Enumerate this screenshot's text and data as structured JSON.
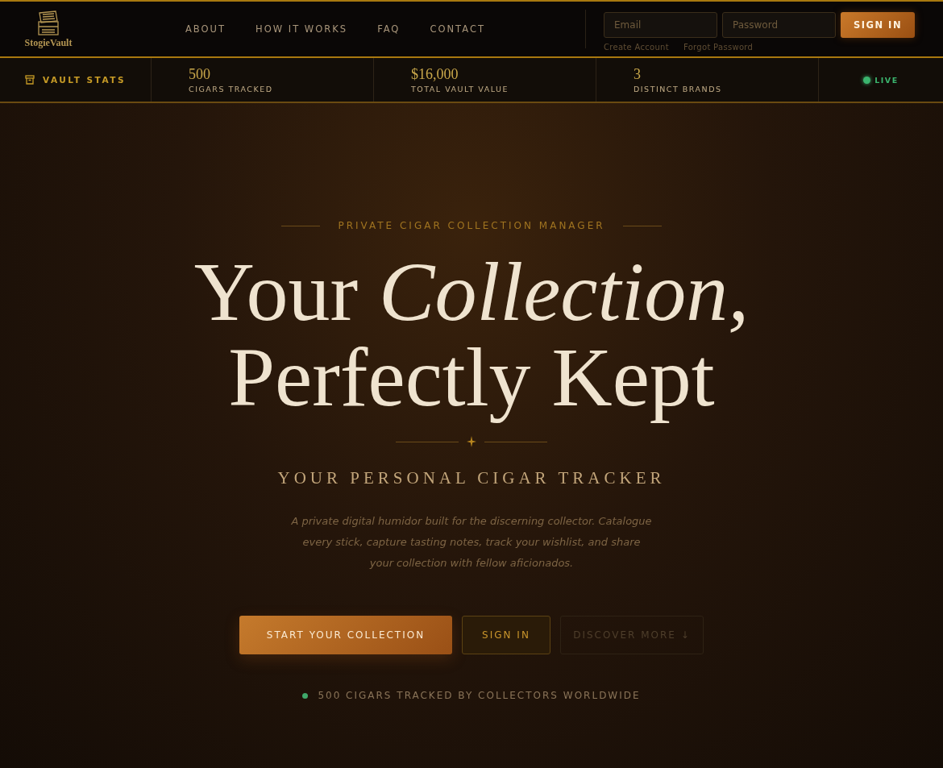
{
  "brand": {
    "name": "StogieVault"
  },
  "nav": [
    "ABOUT",
    "HOW IT WORKS",
    "FAQ",
    "CONTACT"
  ],
  "login": {
    "email_placeholder": "Email",
    "password_placeholder": "Password",
    "button": "SIGN IN",
    "links": [
      "Create Account",
      "Forgot Password"
    ]
  },
  "stats_bar": {
    "title": "VAULT STATS",
    "stats": [
      {
        "value": "500",
        "label": "CIGARS TRACKED"
      },
      {
        "value": "$16,000",
        "label": "TOTAL VAULT VALUE"
      },
      {
        "value": "3",
        "label": "DISTINCT BRANDS"
      }
    ],
    "live": "LIVE"
  },
  "hero": {
    "eyebrow": "PRIVATE CIGAR COLLECTION MANAGER",
    "headline_lines": [
      "Your *Collection,*",
      "Perfectly Kept"
    ],
    "subtitle": "YOUR PERSONAL CIGAR TRACKER",
    "description": "A private digital humidor built for the discerning collector. Catalogue every stick, capture tasting notes, track your wishlist, and share your collection with fellow aficionados.",
    "buttons": [
      {
        "label": "START YOUR COLLECTION",
        "kind": "primary"
      },
      {
        "label": "SIGN IN",
        "kind": "secondary"
      },
      {
        "label": "DISCOVER MORE ↓",
        "kind": "ghost"
      }
    ],
    "footnote": "500 CIGARS TRACKED BY COLLECTORS WORLDWIDE"
  }
}
